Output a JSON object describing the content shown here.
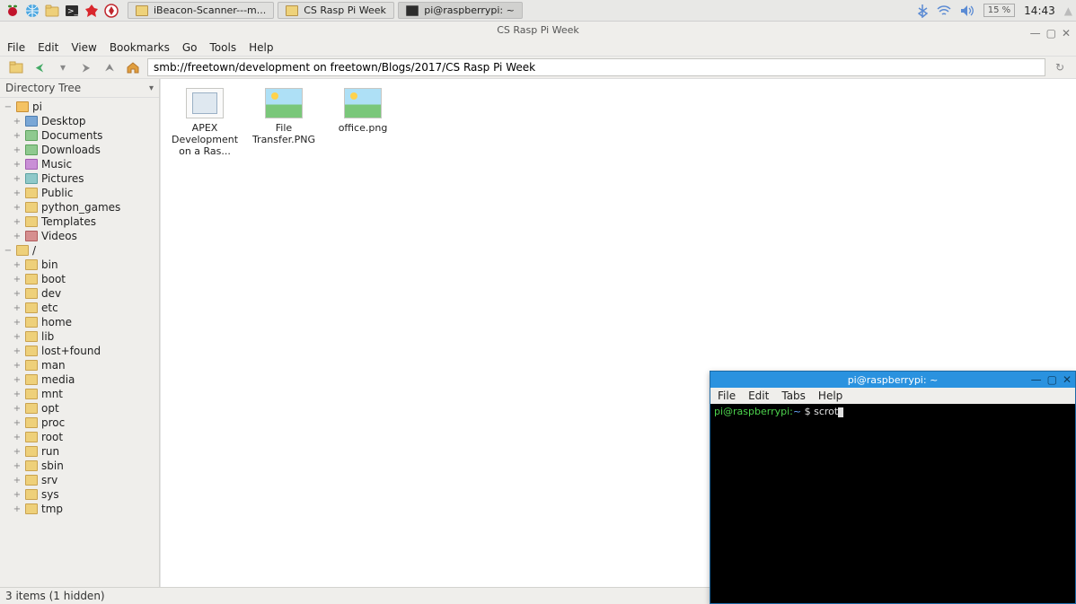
{
  "panel": {
    "tasks": [
      {
        "label": "iBeacon-Scanner---m...",
        "kind": "folder"
      },
      {
        "label": "CS Rasp Pi Week",
        "kind": "folder"
      },
      {
        "label": "pi@raspberrypi: ~",
        "kind": "term",
        "active": true
      }
    ],
    "battery": "15 %",
    "clock": "14:43"
  },
  "fm": {
    "title": "CS Rasp Pi Week",
    "menus": [
      "File",
      "Edit",
      "View",
      "Bookmarks",
      "Go",
      "Tools",
      "Help"
    ],
    "address": "smb://freetown/development on freetown/Blogs/2017/CS Rasp Pi Week",
    "sidebar_header": "Directory Tree",
    "roots": [
      {
        "label": "pi",
        "icon": "home",
        "expander": "−",
        "children": [
          {
            "label": "Desktop",
            "icon": "desk"
          },
          {
            "label": "Documents",
            "icon": "doc"
          },
          {
            "label": "Downloads",
            "icon": "dl"
          },
          {
            "label": "Music",
            "icon": "mus"
          },
          {
            "label": "Pictures",
            "icon": "pic"
          },
          {
            "label": "Public",
            "icon": "folder"
          },
          {
            "label": "python_games",
            "icon": "folder"
          },
          {
            "label": "Templates",
            "icon": "folder"
          },
          {
            "label": "Videos",
            "icon": "vid"
          }
        ]
      },
      {
        "label": "/",
        "icon": "sys",
        "expander": "−",
        "children": [
          {
            "label": "bin",
            "icon": "folder"
          },
          {
            "label": "boot",
            "icon": "folder"
          },
          {
            "label": "dev",
            "icon": "folder"
          },
          {
            "label": "etc",
            "icon": "folder"
          },
          {
            "label": "home",
            "icon": "folder"
          },
          {
            "label": "lib",
            "icon": "folder"
          },
          {
            "label": "lost+found",
            "icon": "folder"
          },
          {
            "label": "man",
            "icon": "folder"
          },
          {
            "label": "media",
            "icon": "folder"
          },
          {
            "label": "mnt",
            "icon": "folder"
          },
          {
            "label": "opt",
            "icon": "folder"
          },
          {
            "label": "proc",
            "icon": "folder"
          },
          {
            "label": "root",
            "icon": "folder"
          },
          {
            "label": "run",
            "icon": "folder"
          },
          {
            "label": "sbin",
            "icon": "folder"
          },
          {
            "label": "srv",
            "icon": "folder"
          },
          {
            "label": "sys",
            "icon": "folder"
          },
          {
            "label": "tmp",
            "icon": "folder"
          }
        ]
      }
    ],
    "files": [
      {
        "label": "APEX Development on a Ras...",
        "kind": "docx"
      },
      {
        "label": "File Transfer.PNG",
        "kind": "img"
      },
      {
        "label": "office.png",
        "kind": "img"
      }
    ],
    "status": "3 items (1 hidden)"
  },
  "term": {
    "title": "pi@raspberrypi: ~",
    "menus": [
      "File",
      "Edit",
      "Tabs",
      "Help"
    ],
    "prompt_user": "pi@raspberrypi",
    "prompt_path": "~",
    "prompt_sep": " $ ",
    "command": "scrot"
  }
}
